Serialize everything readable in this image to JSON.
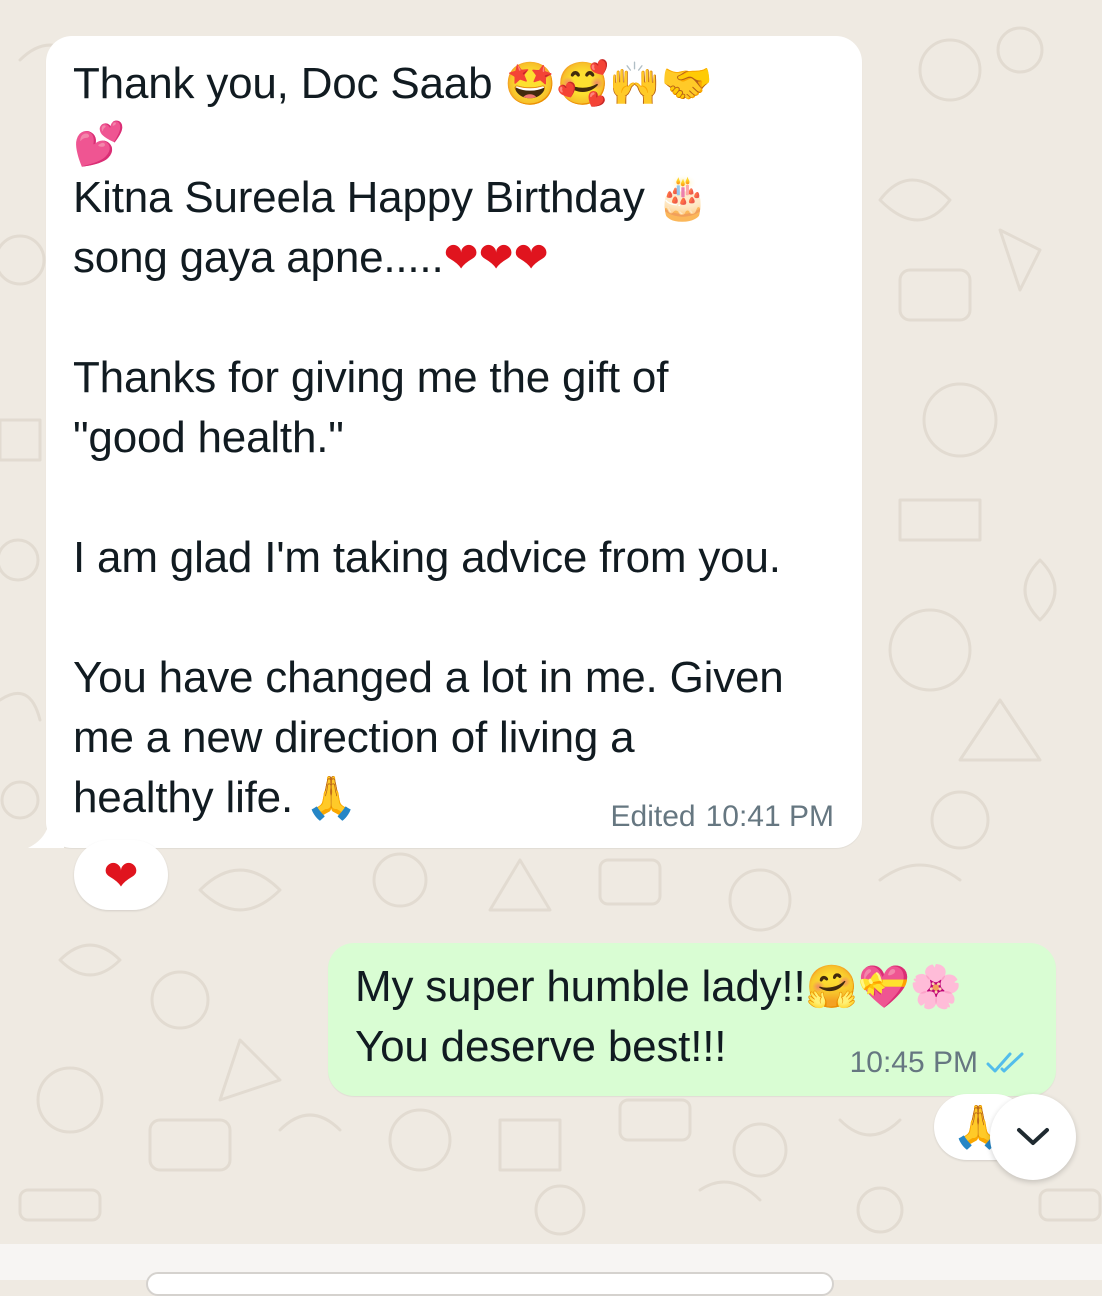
{
  "incoming_message": {
    "lines": [
      {
        "text": "Thank you, Doc Saab ",
        "emoji": "🤩🥰🙌🤝"
      },
      {
        "text": "",
        "emoji": "💕"
      },
      {
        "text": "Kitna Sureela Happy Birthday ",
        "emoji": "🎂"
      },
      {
        "text": "song gaya apne.....",
        "emoji": "❤❤❤"
      },
      {
        "text": "",
        "emoji": ""
      },
      {
        "text": "Thanks for giving me the gift of",
        "emoji": ""
      },
      {
        "text": "\"good health.\"",
        "emoji": ""
      },
      {
        "text": "",
        "emoji": ""
      },
      {
        "text": "I am glad I'm taking advice from you.",
        "emoji": ""
      },
      {
        "text": "",
        "emoji": ""
      },
      {
        "text": "You have changed a lot in me. Given",
        "emoji": ""
      },
      {
        "text": "me a new direction of living a",
        "emoji": ""
      },
      {
        "text": "healthy life. ",
        "emoji": "🙏"
      }
    ],
    "edited_label": "Edited",
    "time": "10:41 PM",
    "reaction": "❤"
  },
  "outgoing_message": {
    "lines": [
      {
        "text": "My super humble lady!!",
        "emoji": "🤗💝🌸"
      },
      {
        "text": "You deserve best!!!",
        "emoji": ""
      }
    ],
    "time": "10:45 PM",
    "read_status": "read",
    "reaction": "🙏"
  },
  "colors": {
    "background": "#efeae2",
    "incoming_bubble": "#ffffff",
    "outgoing_bubble": "#d9fdd3",
    "read_ticks": "#53bdeb",
    "meta_text": "#667781"
  },
  "icons": {
    "scroll_down": "chevron-down-icon",
    "read_receipt": "double-check-icon"
  }
}
